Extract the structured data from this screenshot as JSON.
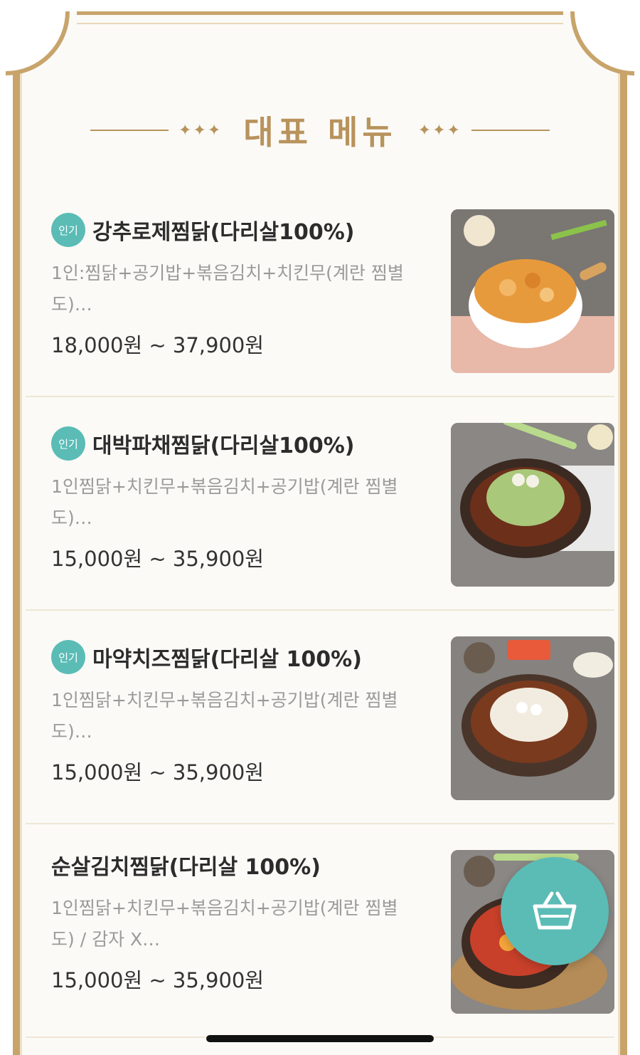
{
  "section": {
    "title": "대표 메뉴",
    "stars_left": "✦✦✦",
    "stars_right": "✦✦✦"
  },
  "menu_items": [
    {
      "badge": "인기",
      "name": "강추로제찜닭(다리살100%)",
      "description": "1인:찜닭+공기밥+볶음김치+치킨무(계란 찜별도)…",
      "price": "18,000원 ~ 37,900원",
      "image_icon": "rose-jjimdak-photo"
    },
    {
      "badge": "인기",
      "name": "대박파채찜닭(다리살100%)",
      "description": "1인찜닭+치킨무+볶음김치+공기밥(계란 찜별도)…",
      "price": "15,000원 ~ 35,900원",
      "image_icon": "green-onion-jjimdak-photo"
    },
    {
      "badge": "인기",
      "name": "마약치즈찜닭(다리살 100%)",
      "description": "1인찜닭+치킨무+볶음김치+공기밥(계란 찜별도)…",
      "price": "15,000원 ~ 35,900원",
      "image_icon": "cheese-jjimdak-photo"
    },
    {
      "badge": "",
      "name": "순살김치찜닭(다리살 100%)",
      "description": "1인찜닭+치킨무+볶음김치+공기밥(계란 찜별도) / 감자 X…",
      "price": "15,000원 ~ 35,900원",
      "image_icon": "kimchi-jjimdak-photo"
    }
  ],
  "cart_button": {
    "icon": "basket-icon"
  },
  "colors": {
    "accent": "#5bbcb6",
    "gold": "#c8a46b"
  }
}
